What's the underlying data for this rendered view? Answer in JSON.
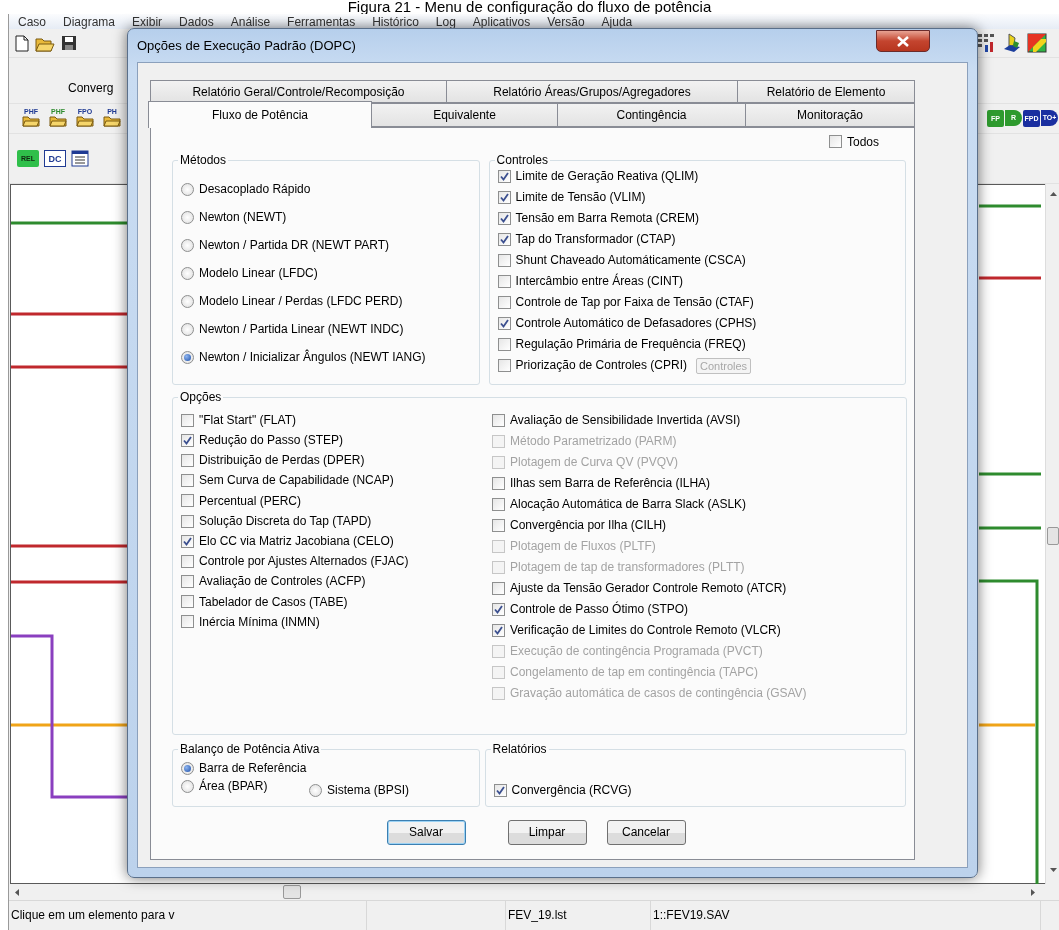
{
  "caption": "Figura 21 - Menu de configuração do fluxo de potência",
  "menu": [
    "Caso",
    "Diagrama",
    "Exibir",
    "Dados",
    "Análise",
    "Ferramentas",
    "Histórico",
    "Log",
    "Aplicativos",
    "Versão",
    "Ajuda"
  ],
  "toolbar": {
    "label": "Converg",
    "left_buttons": [
      {
        "label": "PHF",
        "kind": "folder",
        "color": "#1f3a93"
      },
      {
        "label": "PHF",
        "kind": "folder",
        "color": "#2e8b2e"
      },
      {
        "label": "FPO",
        "kind": "folder",
        "color": "#1f3a93"
      },
      {
        "label": "PH",
        "kind": "folder",
        "color": "#1f3a93"
      }
    ],
    "report_buttons": [
      {
        "label": "REL",
        "kind": "badge",
        "color": "#2fbf4a"
      },
      {
        "label": "DC",
        "kind": "box",
        "color": "#1f3a93"
      }
    ],
    "right_buttons": [
      {
        "label": "FP",
        "kind": "badge",
        "color": "#2e9a2e"
      },
      {
        "label": "R",
        "kind": "arrow",
        "color": "#2e9a2e"
      },
      {
        "label": "FPD",
        "kind": "badge",
        "color": "#1a2fa0"
      },
      {
        "label": "TO+",
        "kind": "arrow",
        "color": "#1a2fa0"
      }
    ]
  },
  "dialog": {
    "title": "Opções de Execução Padrão (DOPC)",
    "tab_rows": [
      [
        {
          "label": "Relatório Geral/Controle/Recomposição",
          "selected": false
        },
        {
          "label": "Relatório Áreas/Grupos/Agregadores",
          "selected": false
        },
        {
          "label": "Relatório de Elemento",
          "selected": false
        }
      ],
      [
        {
          "label": "Fluxo de Potência",
          "selected": true
        },
        {
          "label": "Equivalente",
          "selected": false
        },
        {
          "label": "Contingência",
          "selected": false
        },
        {
          "label": "Monitoração",
          "selected": false
        }
      ]
    ],
    "select_all": {
      "label": "Todos",
      "checked": false
    },
    "methods": {
      "title": "Métodos",
      "options": [
        {
          "label": "Desacoplado Rápido",
          "selected": false
        },
        {
          "label": "Newton (NEWT)",
          "selected": false
        },
        {
          "label": "Newton / Partida DR (NEWT PART)",
          "selected": false
        },
        {
          "label": "Modelo Linear (LFDC)",
          "selected": false
        },
        {
          "label": "Modelo Linear / Perdas (LFDC PERD)",
          "selected": false
        },
        {
          "label": "Newton / Partida Linear (NEWT INDC)",
          "selected": false
        },
        {
          "label": "Newton / Inicializar Ângulos (NEWT IANG)",
          "selected": true
        }
      ]
    },
    "controls": {
      "title": "Controles",
      "items": [
        {
          "label": "Limite de Geração Reativa (QLIM)",
          "checked": true
        },
        {
          "label": "Limite de Tensão (VLIM)",
          "checked": true
        },
        {
          "label": "Tensão em Barra Remota (CREM)",
          "checked": true
        },
        {
          "label": "Tap do Transformador (CTAP)",
          "checked": true
        },
        {
          "label": "Shunt Chaveado Automáticamente (CSCA)",
          "checked": false
        },
        {
          "label": "Intercâmbio entre Áreas (CINT)",
          "checked": false
        },
        {
          "label": "Controle de Tap por Faixa de Tensão (CTAF)",
          "checked": false
        },
        {
          "label": "Controle Automático de Defasadores (CPHS)",
          "checked": true
        },
        {
          "label": "Regulação Primária de Frequência (FREQ)",
          "checked": false
        },
        {
          "label": "Priorização de Controles (CPRI)",
          "checked": false
        }
      ],
      "button": {
        "label": "Controles",
        "disabled": true
      }
    },
    "options": {
      "title": "Opções",
      "left": [
        {
          "label": "\"Flat Start\" (FLAT)",
          "checked": false,
          "disabled": false
        },
        {
          "label": "Redução do Passo (STEP)",
          "checked": true,
          "disabled": false
        },
        {
          "label": "Distribuição de Perdas (DPER)",
          "checked": false,
          "disabled": false
        },
        {
          "label": "Sem Curva de Capabilidade (NCAP)",
          "checked": false,
          "disabled": false
        },
        {
          "label": "Percentual (PERC)",
          "checked": false,
          "disabled": false
        },
        {
          "label": "Solução Discreta do Tap (TAPD)",
          "checked": false,
          "disabled": false
        },
        {
          "label": "Elo CC via Matriz Jacobiana (CELO)",
          "checked": true,
          "disabled": false
        },
        {
          "label": "Controle por Ajustes Alternados (FJAC)",
          "checked": false,
          "disabled": false
        },
        {
          "label": "Avaliação de Controles (ACFP)",
          "checked": false,
          "disabled": false
        },
        {
          "label": "Tabelador de Casos (TABE)",
          "checked": false,
          "disabled": false
        },
        {
          "label": "Inércia Mínima (INMN)",
          "checked": false,
          "disabled": false
        }
      ],
      "right": [
        {
          "label": "Avaliação de Sensibilidade Invertida (AVSI)",
          "checked": false,
          "disabled": false
        },
        {
          "label": "Método Parametrizado (PARM)",
          "checked": false,
          "disabled": true
        },
        {
          "label": "Plotagem de Curva QV (PVQV)",
          "checked": false,
          "disabled": true
        },
        {
          "label": "Ilhas sem Barra de Referência (ILHA)",
          "checked": false,
          "disabled": false
        },
        {
          "label": "Alocação Automática de Barra Slack (ASLK)",
          "checked": false,
          "disabled": false
        },
        {
          "label": "Convergência por Ilha (CILH)",
          "checked": false,
          "disabled": false
        },
        {
          "label": "Plotagem de Fluxos (PLTF)",
          "checked": false,
          "disabled": true
        },
        {
          "label": "Plotagem de tap de transformadores (PLTT)",
          "checked": false,
          "disabled": true
        },
        {
          "label": "Ajuste da Tensão Gerador Controle Remoto (ATCR)",
          "checked": false,
          "disabled": false
        },
        {
          "label": "Controle de Passo Ótimo (STPO)",
          "checked": true,
          "disabled": false
        },
        {
          "label": "Verificação de Limites do Controle Remoto (VLCR)",
          "checked": true,
          "disabled": false
        },
        {
          "label": "Execução de contingência Programada (PVCT)",
          "checked": false,
          "disabled": true
        },
        {
          "label": "Congelamento de tap em contingência (TAPC)",
          "checked": false,
          "disabled": true
        },
        {
          "label": "Gravação automática de casos de contingência (GSAV)",
          "checked": false,
          "disabled": true
        }
      ]
    },
    "balance": {
      "title": "Balanço de Potência Ativa",
      "options": [
        {
          "label": "Barra de Referência",
          "selected": true
        },
        {
          "label": "Área (BPAR)",
          "selected": false
        },
        {
          "label": "Sistema (BPSI)",
          "selected": false
        }
      ]
    },
    "reports": {
      "title": "Relatórios",
      "items": [
        {
          "label": "Convergência (RCVG)",
          "checked": true
        }
      ]
    },
    "buttons": [
      {
        "label": "Salvar",
        "default": true
      },
      {
        "label": "Limpar",
        "default": false
      },
      {
        "label": "Cancelar",
        "default": false
      }
    ]
  },
  "status_bar": {
    "message": "Clique em um elemento para v",
    "file": "FEV_19.lst",
    "case": "1::FEV19.SAV"
  }
}
